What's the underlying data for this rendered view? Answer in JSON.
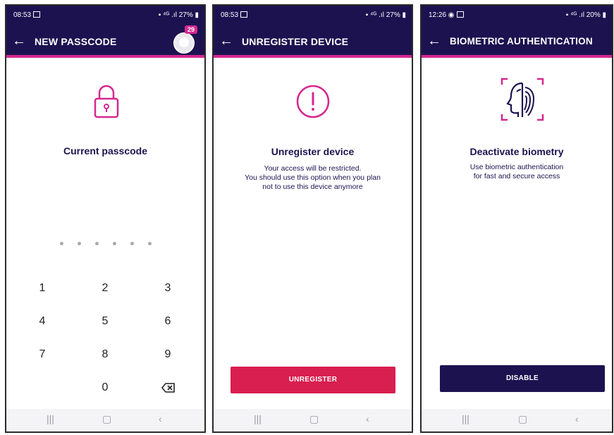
{
  "screens": [
    {
      "status": {
        "time": "08:53",
        "indicators": "27%"
      },
      "title": "NEW PASSCODE",
      "badge": "29",
      "heading": "Current passcode",
      "keypad": [
        "1",
        "2",
        "3",
        "4",
        "5",
        "6",
        "7",
        "8",
        "9",
        "0"
      ],
      "icons": {
        "back": "back-arrow-icon",
        "main": "lock-icon",
        "delete": "backspace-icon"
      }
    },
    {
      "status": {
        "time": "08:53",
        "indicators": "27%"
      },
      "title": "UNREGISTER DEVICE",
      "heading": "Unregister device",
      "desc": [
        "Your access will be restricted.",
        "You should use this option when you plan",
        "not to use this device anymore"
      ],
      "button": "UNREGISTER",
      "icons": {
        "back": "back-arrow-icon",
        "main": "exclamation-circle-icon"
      }
    },
    {
      "status": {
        "time": "12:26",
        "indicators": "20%"
      },
      "title": "BIOMETRIC AUTHENTICATION",
      "heading": "Deactivate biometry",
      "desc": [
        "Use biometric authentication",
        "for fast and secure access"
      ],
      "button": "DISABLE",
      "icons": {
        "back": "back-arrow-icon",
        "main": "face-fingerprint-icon"
      }
    }
  ],
  "colors": {
    "navy": "#1d1250",
    "magenta": "#d5288f",
    "red_button": "#d81f4f"
  },
  "nav_icons": [
    "recent-apps-icon",
    "home-icon",
    "back-icon"
  ]
}
